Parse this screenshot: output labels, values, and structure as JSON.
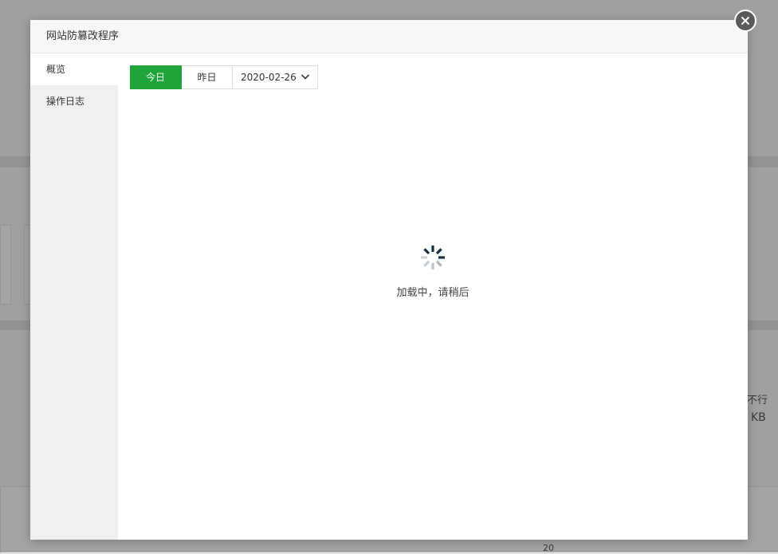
{
  "modal": {
    "title": "网站防篡改程序",
    "close_icon": "close-icon"
  },
  "sidebar": {
    "items": [
      {
        "label": "概览",
        "active": true
      },
      {
        "label": "操作日志",
        "active": false
      }
    ]
  },
  "toolbar": {
    "tabs": [
      {
        "label": "今日",
        "active": true
      },
      {
        "label": "昨日",
        "active": false
      }
    ],
    "date_value": "2020-02-26",
    "date_icon": "chevron-down-icon"
  },
  "loading": {
    "text": "加载中，请稍后",
    "icon": "spinner-icon"
  },
  "background": {
    "right_text_1": "不行",
    "right_text_2": "KB",
    "axis_label": "20"
  },
  "colors": {
    "accent": "#20a53a",
    "spinner": "#1b2d44"
  }
}
